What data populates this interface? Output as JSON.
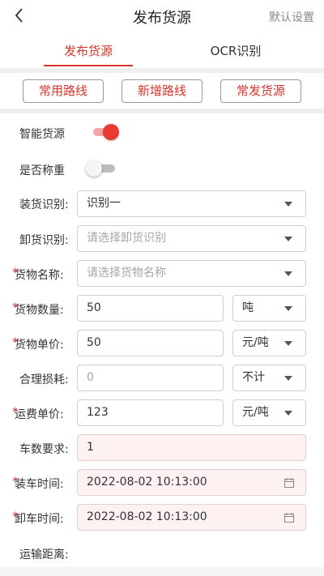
{
  "navbar": {
    "title": "发布货源",
    "right_action": "默认设置"
  },
  "tabs": [
    {
      "label": "发布货源",
      "active": true
    },
    {
      "label": "OCR识别",
      "active": false
    }
  ],
  "quick_buttons": [
    "常用路线",
    "新增路线",
    "常发货源"
  ],
  "toggles": {
    "smart_source": {
      "label": "智能货源",
      "on": true
    },
    "weighing": {
      "label": "是否称重",
      "on": false
    }
  },
  "form": {
    "loading_id": {
      "label": "装货识别:",
      "value": "识别一"
    },
    "unloading_id": {
      "label": "卸货识别:",
      "placeholder": "请选择卸货识别"
    },
    "cargo_name": {
      "label": "货物名称:",
      "placeholder": "请选择货物名称",
      "required": "*"
    },
    "cargo_qty": {
      "label": "货物数量:",
      "value": "50",
      "unit": "吨",
      "required": "*"
    },
    "cargo_price": {
      "label": "货物单价:",
      "value": "50",
      "unit": "元/吨",
      "required": "*"
    },
    "reasonable_loss": {
      "label": "合理损耗:",
      "value": "0",
      "unit": "不计"
    },
    "freight_price": {
      "label": "运费单价:",
      "value": "123",
      "unit": "元/吨",
      "required": "*"
    },
    "vehicle_count": {
      "label": "车数要求:",
      "value": "1"
    },
    "load_time": {
      "label": "装车时间:",
      "value": "2022-08-02 10:13:00",
      "required": "*"
    },
    "unload_time": {
      "label": "卸车时间:",
      "value": "2022-08-02 10:13:00",
      "required": "*"
    },
    "distance": {
      "label": "运输距离:"
    }
  },
  "colors": {
    "accent": "#d9352c",
    "toggle_on": "#e83a30",
    "pink_field": "#fdf1f1"
  }
}
